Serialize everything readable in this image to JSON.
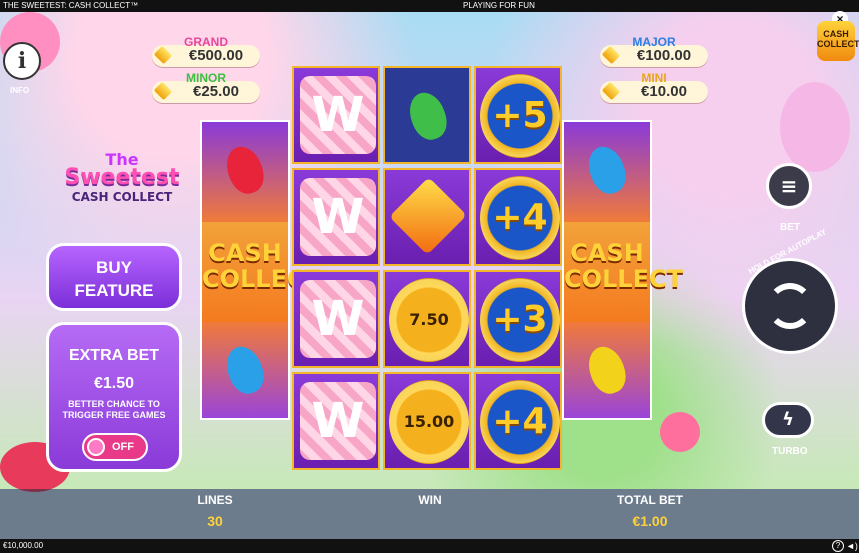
{
  "top": {
    "game_title": "THE SWEETEST: CASH COLLECT™",
    "mode": "PLAYING FOR FUN"
  },
  "info": {
    "label": "INFO"
  },
  "jackpots": [
    {
      "label": "GRAND",
      "value": "€500.00",
      "label_color": "#e8489a"
    },
    {
      "label": "MINOR",
      "value": "€25.00",
      "label_color": "#3cbf3c"
    },
    {
      "label": "MAJOR",
      "value": "€100.00",
      "label_color": "#2a7fe0"
    },
    {
      "label": "MINI",
      "value": "€10.00",
      "label_color": "#e8a71a"
    }
  ],
  "logo": {
    "line1": "The",
    "line2": "Sweetest",
    "line3": "CASH COLLECT"
  },
  "buy_feature": {
    "line1": "BUY",
    "line2": "FEATURE"
  },
  "extra_bet": {
    "title": "EXTRA BET",
    "price": "€1.50",
    "desc": "BETTER CHANCE TO TRIGGER FREE GAMES",
    "toggle": "OFF"
  },
  "reels": {
    "center": [
      [
        {
          "type": "w"
        },
        {
          "type": "w"
        },
        {
          "type": "w"
        },
        {
          "type": "w"
        }
      ],
      [
        {
          "type": "bean",
          "color": "#3fbf4a"
        },
        {
          "type": "gem"
        },
        {
          "type": "gold",
          "value": "7.50"
        },
        {
          "type": "gold",
          "value": "15.00"
        }
      ],
      [
        {
          "type": "coin",
          "value": "+5"
        },
        {
          "type": "coin",
          "value": "+4"
        },
        {
          "type": "coin",
          "value": "+3"
        },
        {
          "type": "coin",
          "value": "+4"
        }
      ]
    ],
    "left": {
      "top_bean": "#e8243a",
      "bottom_bean": "#2aa0e8",
      "symbol_line1": "CASH",
      "symbol_line2": "COLLECT"
    },
    "right": {
      "top_bean": "#2aa0e8",
      "bottom_bean": "#f2d21a",
      "symbol_line1": "CASH",
      "symbol_line2": "COLLECT"
    }
  },
  "right_controls": {
    "bet_label": "BET",
    "autoplay_label": "HOLD FOR AUTOPLAY",
    "turbo_label": "TURBO",
    "corner_logo_line1": "CASH",
    "corner_logo_line2": "COLLECT"
  },
  "bottom": {
    "lines_label": "LINES",
    "lines_value": "30",
    "win_label": "WIN",
    "total_bet_label": "TOTAL BET",
    "total_bet_value": "€1.00"
  },
  "footer": {
    "balance": "€10,000.00"
  }
}
